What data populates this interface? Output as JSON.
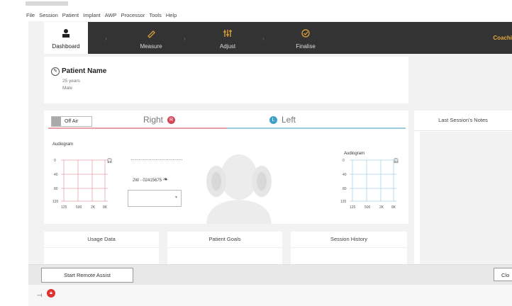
{
  "menu": [
    "File",
    "Session",
    "Patient",
    "Implant",
    "AWP",
    "Processor",
    "Tools",
    "Help"
  ],
  "nav": {
    "steps": [
      {
        "label": "Dashboard",
        "icon": "person-icon",
        "active": true
      },
      {
        "label": "Measure",
        "icon": "pencil-icon",
        "active": false
      },
      {
        "label": "Adjust",
        "icon": "sliders-icon",
        "active": false
      },
      {
        "label": "Finalise",
        "icon": "check-circle-icon",
        "active": false
      }
    ],
    "coaching": "Coachi"
  },
  "patient": {
    "name": "Patient Name",
    "age": "25 years",
    "sex": "Male"
  },
  "ears": {
    "off_air": "Off Air",
    "right_label": "Right",
    "right_badge": "R",
    "left_label": "Left",
    "left_badge": "L",
    "right_audiogram_title": "Audiogram",
    "left_audiogram_title": "Audiogram",
    "right_y_ticks": [
      "0",
      "40",
      "80",
      "120"
    ],
    "left_y_ticks": [
      "0",
      "40",
      "80",
      "120"
    ],
    "x_ticks": [
      "125",
      "500",
      "2K",
      "8K"
    ],
    "device_label": "2W - 02415675"
  },
  "cards": [
    "Usage Data",
    "Patient Goals",
    "Session History"
  ],
  "notes": {
    "title": "Last Session's Notes"
  },
  "footer": {
    "remote_assist": "Start Remote Assist",
    "close": "Clo"
  },
  "colors": {
    "nav_bg": "#333333",
    "right": "#d2485a",
    "left": "#3e9fc8",
    "coach": "#e6a83a"
  }
}
